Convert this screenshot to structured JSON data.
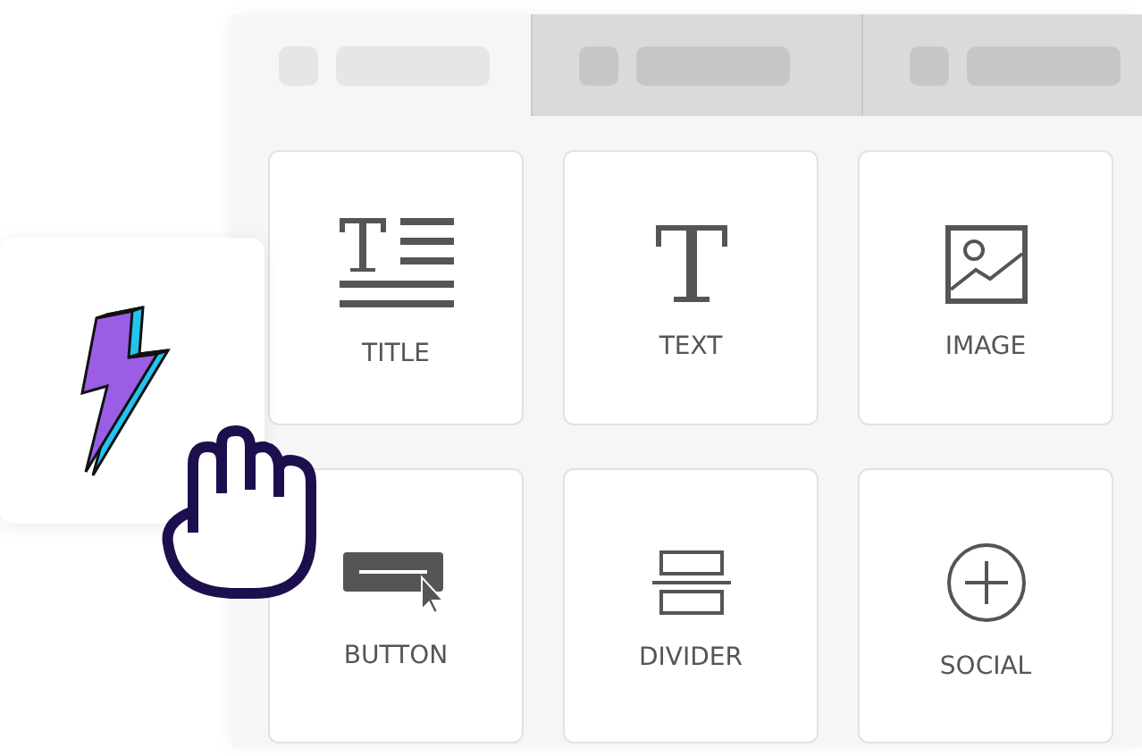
{
  "tabs": [
    {
      "selected": true
    },
    {
      "selected": false
    },
    {
      "selected": false
    }
  ],
  "blocks": [
    {
      "kind": "title",
      "label": "TITLE"
    },
    {
      "kind": "text",
      "label": "TEXT"
    },
    {
      "kind": "image",
      "label": "IMAGE"
    },
    {
      "kind": "button",
      "label": "BUTTON"
    },
    {
      "kind": "divider",
      "label": "DIVIDER"
    },
    {
      "kind": "social",
      "label": "SOCIAL"
    }
  ]
}
